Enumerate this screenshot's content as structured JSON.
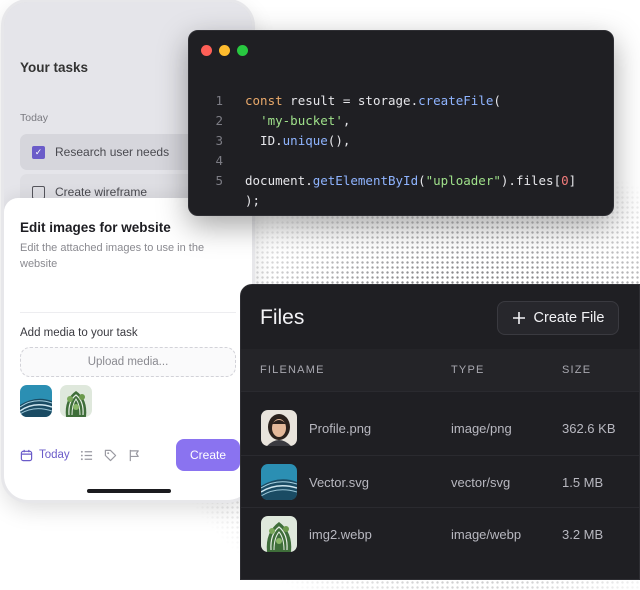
{
  "phone": {
    "tasks_title": "Your tasks",
    "section": "Today",
    "tasks": [
      {
        "label": "Research user needs",
        "checked": true
      },
      {
        "label": "Create wireframe",
        "checked": false
      }
    ],
    "sheet": {
      "title": "Edit images for website",
      "description": "Edit the attached images to use in the website",
      "media_label": "Add media to your task",
      "upload_label": "Upload media...",
      "today_label": "Today",
      "create_label": "Create"
    }
  },
  "code": {
    "lines": [
      {
        "n": "1"
      },
      {
        "n": "2"
      },
      {
        "n": "3"
      },
      {
        "n": "4"
      },
      {
        "n": "5"
      }
    ],
    "tokens": {
      "l1_kw": "const",
      "l1_plain": " result = storage.",
      "l1_fn": "createFile",
      "l1_end": "(",
      "l2_indent": "  ",
      "l2_str": "'my-bucket'",
      "l2_end": ",",
      "l3_plain": "  ID.",
      "l3_fn": "unique",
      "l3_end": "(),",
      "l5_plain": "document.",
      "l5_fn": "getElementById",
      "l5_paren": "(",
      "l5_str": "\"uploader\"",
      "l5_mid": ").files[",
      "l5_num": "0",
      "l5_end": "]",
      "l6_plain": ");"
    }
  },
  "files": {
    "title": "Files",
    "create_button": "Create File",
    "headers": [
      "FILENAME",
      "TYPE",
      "SIZE"
    ],
    "rows": [
      {
        "name": "Profile.png",
        "type": "image/png",
        "size": "362.6 KB"
      },
      {
        "name": "Vector.svg",
        "type": "vector/svg",
        "size": "1.5 MB"
      },
      {
        "name": "img2.webp",
        "type": "image/webp",
        "size": "3.2 MB"
      }
    ]
  },
  "colors": {
    "accent": "#8a73f0",
    "code_bg": "#1f1f23",
    "keyword": "#e9a96b",
    "function": "#8fb4ff",
    "string": "#9fe08a",
    "number": "#f47c7c"
  }
}
